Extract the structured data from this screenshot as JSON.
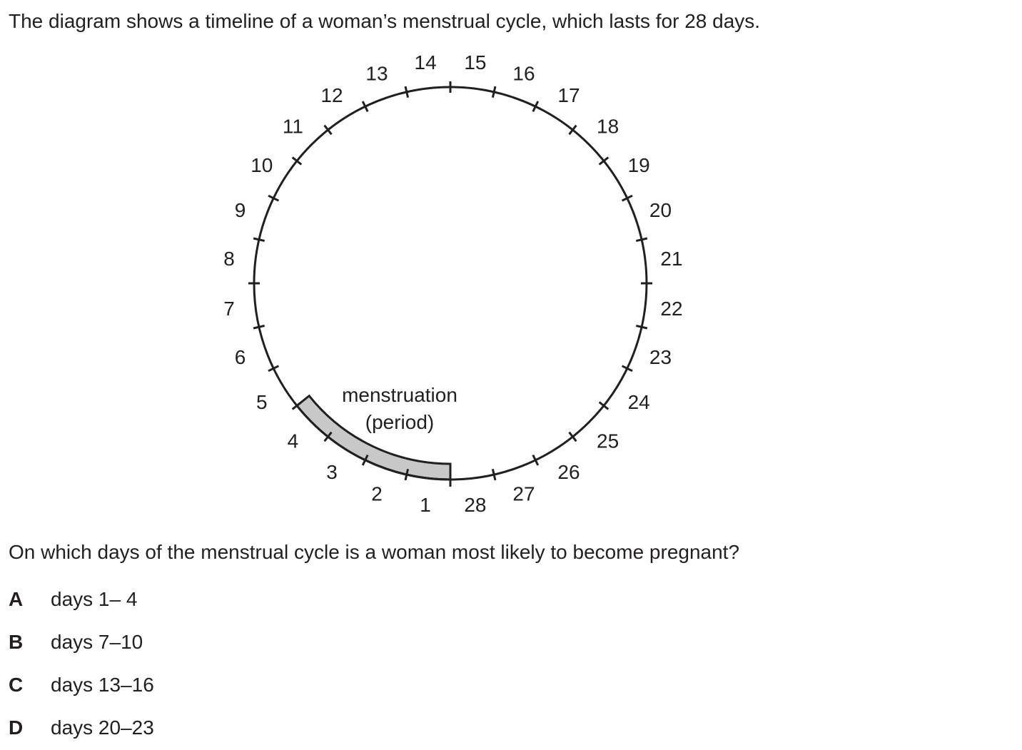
{
  "intro": "The diagram shows a timeline of a woman’s menstrual cycle, which lasts for 28 days.",
  "diagram": {
    "day_labels": [
      "1",
      "2",
      "3",
      "4",
      "5",
      "6",
      "7",
      "8",
      "9",
      "10",
      "11",
      "12",
      "13",
      "14",
      "15",
      "16",
      "17",
      "18",
      "19",
      "20",
      "21",
      "22",
      "23",
      "24",
      "25",
      "26",
      "27",
      "28"
    ],
    "menstruation_label_line1": "menstruation",
    "menstruation_label_line2": "(period)",
    "shaded_days": {
      "from": 1,
      "to": 5
    },
    "line_color": "#231f20",
    "shade_color": "#c8c8c8"
  },
  "question": "On which days of the menstrual cycle is a woman most likely to become pregnant?",
  "options": [
    {
      "letter": "A",
      "text": "days 1– 4"
    },
    {
      "letter": "B",
      "text": "days 7–10"
    },
    {
      "letter": "C",
      "text": "days 13–16"
    },
    {
      "letter": "D",
      "text": "days 20–23"
    }
  ]
}
